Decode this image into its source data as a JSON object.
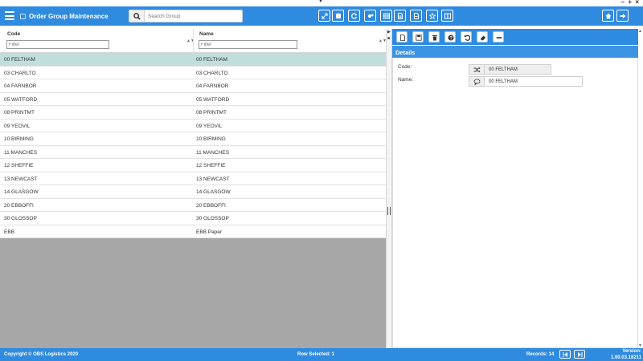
{
  "header": {
    "title": "Order Group Maintenance",
    "search_placeholder": "Search Group",
    "toolbar_icons": [
      "expand-icon",
      "database-icon",
      "refresh-icon",
      "settings-group-icon",
      "grid-view-icon",
      "document-icon",
      "document-alt-icon",
      "star-icon",
      "panel-icon"
    ],
    "right_icons": [
      "home-icon",
      "logout-icon"
    ],
    "window_controls": "– + ×",
    "accent_color": "#2f8be0"
  },
  "grid": {
    "columns": [
      {
        "label": "Code",
        "filter_placeholder": "Filter"
      },
      {
        "label": "Name",
        "filter_placeholder": "Filter"
      }
    ],
    "rows": [
      {
        "code": "00 FELTHAM",
        "name": "00 FELTHAM",
        "selected": true
      },
      {
        "code": "03 CHARLTO",
        "name": "03 CHARLTO"
      },
      {
        "code": "04 FARNBOR",
        "name": "04 FARNBOR"
      },
      {
        "code": "05 WATFORD",
        "name": "05 WATFORD"
      },
      {
        "code": "08 PRINTMT",
        "name": "08 PRINTMT"
      },
      {
        "code": "09 YEOVIL",
        "name": "09 YEOVIL"
      },
      {
        "code": "10 BIRMING",
        "name": "10 BIRMING"
      },
      {
        "code": "11 MANCHES",
        "name": "11 MANCHES"
      },
      {
        "code": "12 SHEFFIE",
        "name": "12 SHEFFIE"
      },
      {
        "code": "13 NEWCAST",
        "name": "13 NEWCAST"
      },
      {
        "code": "14 GLASGOW",
        "name": "14 GLASGOW"
      },
      {
        "code": "20 EBBOFFI",
        "name": "20 EBBOFFI"
      },
      {
        "code": "30 GLOSSOP",
        "name": "30 GLOSSOP"
      },
      {
        "code": "EBB",
        "name": "EBB Paper"
      }
    ]
  },
  "details": {
    "toolbar_icons": [
      "new-icon",
      "save-icon",
      "delete-icon",
      "help-icon",
      "undo-icon",
      "eraser-icon",
      "minus-icon"
    ],
    "title": "Details",
    "code_label": "Code:",
    "code_value": "00 FELTHAM",
    "name_label": "Name:",
    "name_value": "00 FELTHAM"
  },
  "footer": {
    "copyright": "Copyright © OBS Logistics 2020",
    "row_selected": "Row Selected: 1",
    "records": "Records: 14",
    "version_label": "Version:",
    "version_value": "1.00.03.18211"
  }
}
